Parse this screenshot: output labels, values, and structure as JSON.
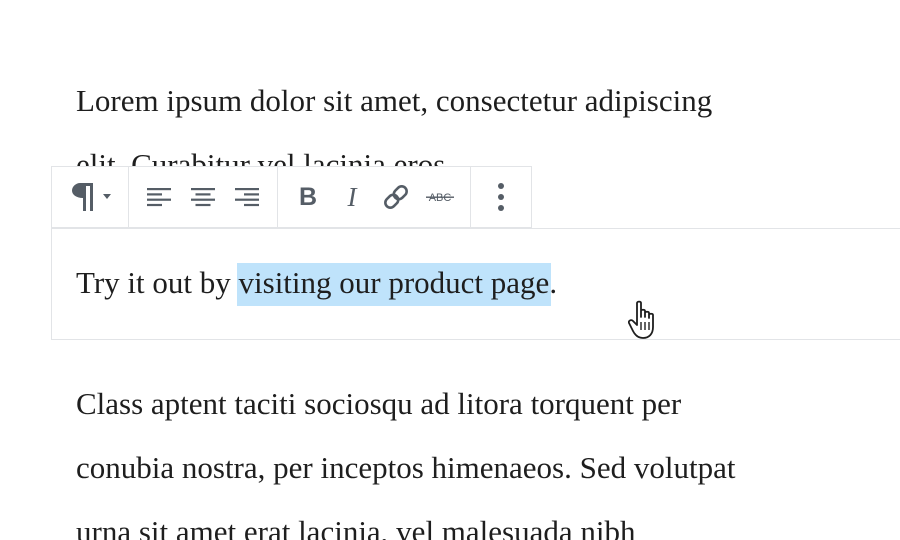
{
  "editor": {
    "paragraph_1_line_1": "Lorem ipsum dolor sit amet, consectetur adipiscing",
    "paragraph_1_line_2": "elit. Curabitur vel lacinia eros",
    "selected_block": {
      "text_before": "Try it out by ",
      "selected_text": "visiting our product page",
      "text_after": "."
    },
    "paragraph_3_line_1": "Class aptent taciti sociosqu ad litora torquent per",
    "paragraph_3_line_2": "conubia nostra, per inceptos himenaeos. Sed volutpat",
    "paragraph_3_line_3": "urna sit amet erat lacinia, vel malesuada nibh"
  },
  "toolbar": {
    "block_type_icon": "paragraph-icon",
    "bold_label": "B",
    "italic_label": "I",
    "strikethrough_label": "ABC"
  },
  "colors": {
    "selection_highlight": "#bfe3fb",
    "icon_color": "#555d66",
    "border_color": "#e2e4e7"
  }
}
